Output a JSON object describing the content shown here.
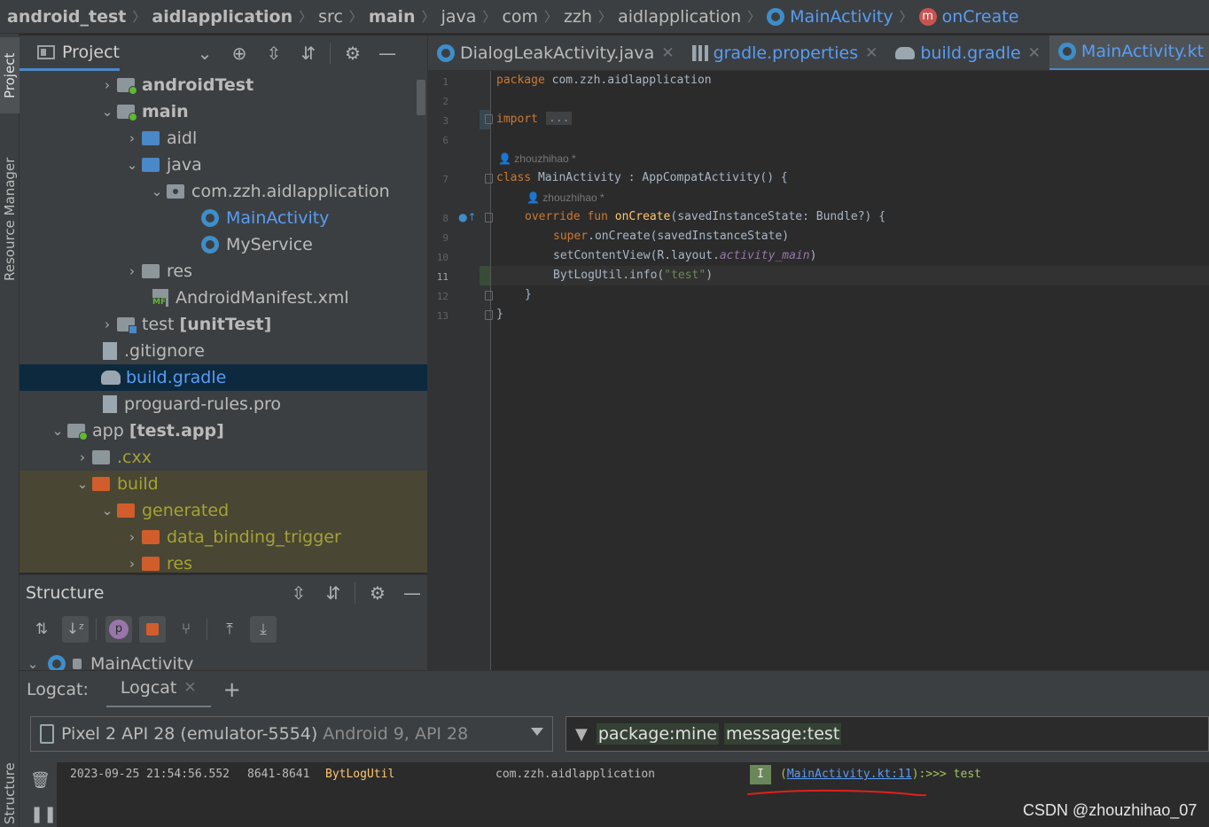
{
  "breadcrumb": {
    "items": [
      "android_test",
      "aidlapplication",
      "src",
      "main",
      "java",
      "com",
      "zzh",
      "aidlapplication",
      "MainActivity",
      "onCreate"
    ]
  },
  "left_stripe": {
    "project_tab": "Project",
    "resource_manager_tab": "Resource Manager",
    "structure_tab": "Structure"
  },
  "project_panel": {
    "title": "Project",
    "icons": [
      "chevron-down-icon",
      "crosshair-icon",
      "expand-all-icon",
      "collapse-all-icon",
      "gear-icon",
      "minimize-icon"
    ],
    "tree": [
      {
        "label": "androidTest",
        "bold": true
      },
      {
        "label": "main",
        "bold": true
      },
      {
        "label": "aidl"
      },
      {
        "label": "java"
      },
      {
        "label": "com.zzh.aidlapplication"
      },
      {
        "label": "MainActivity"
      },
      {
        "label": "MyService"
      },
      {
        "label": "res"
      },
      {
        "label": "AndroidManifest.xml"
      },
      {
        "label": "test",
        "suffix": "[unitTest]"
      },
      {
        "label": ".gitignore"
      },
      {
        "label": "build.gradle"
      },
      {
        "label": "proguard-rules.pro"
      },
      {
        "label": "app",
        "suffix": "[test.app]"
      },
      {
        "label": ".cxx"
      },
      {
        "label": "build"
      },
      {
        "label": "generated"
      },
      {
        "label": "data_binding_trigger"
      },
      {
        "label": "res"
      }
    ]
  },
  "structure_panel": {
    "title": "Structure",
    "root": "MainActivity",
    "p_badge": "p",
    "icons": [
      "sort-visibility-icon",
      "sort-alpha-icon",
      "properties-icon",
      "lock-icon",
      "inherited-icon",
      "expand-icon",
      "collapse-icon"
    ]
  },
  "editor": {
    "tabs": [
      {
        "label": "DialogLeakActivity.java",
        "icon": "java-class-icon"
      },
      {
        "label": "gradle.properties",
        "icon": "properties-file-icon"
      },
      {
        "label": "build.gradle",
        "icon": "gradle-icon"
      },
      {
        "label": "MainActivity.kt",
        "icon": "kotlin-class-icon",
        "active": true
      }
    ],
    "line_numbers": [
      "1",
      "2",
      "3",
      "6",
      "7",
      "8",
      "9",
      "10",
      "11",
      "12",
      "13"
    ],
    "author_hint": "zhouzhihao *",
    "code": {
      "l1_kw": "package",
      "l1_rest": " com.zzh.aidlapplication",
      "l3_kw": "import",
      "l3_fold": "...",
      "l7_kw": "class",
      "l7_rest": " MainActivity : AppCompatActivity() {",
      "l8_kw1": "override",
      "l8_kw2": "fun",
      "l8_fn": "onCreate",
      "l8_rest": "(savedInstanceState: Bundle?) {",
      "l9_kw": "super",
      "l9_rest": ".onCreate(savedInstanceState)",
      "l10_a": "setContentView(R.layout.",
      "l10_it": "activity_main",
      "l10_b": ")",
      "l11_a": "BytLogUtil.info(",
      "l11_str": "\"test\"",
      "l11_b": ")",
      "l12": "}",
      "l13": "}"
    }
  },
  "logcat": {
    "label": "Logcat:",
    "tab": "Logcat",
    "add_icon": "plus-icon",
    "device": "Pixel 2 API 28 (emulator-5554)",
    "device_detail": "Android 9, API 28",
    "filter_tokens": [
      "package:mine",
      "message:test"
    ],
    "entry": {
      "timestamp": "2023-09-25 21:54:56.552",
      "pid_tid": "8641-8641",
      "tag": "BytLogUtil",
      "package": "com.zzh.aidlapplication",
      "level": "I",
      "link_prefix": "(",
      "link": "MainActivity.kt:11",
      "message": "):>>> test"
    },
    "annotation_color": "#e0201b"
  },
  "watermark": "CSDN @zhouzhihao_07"
}
